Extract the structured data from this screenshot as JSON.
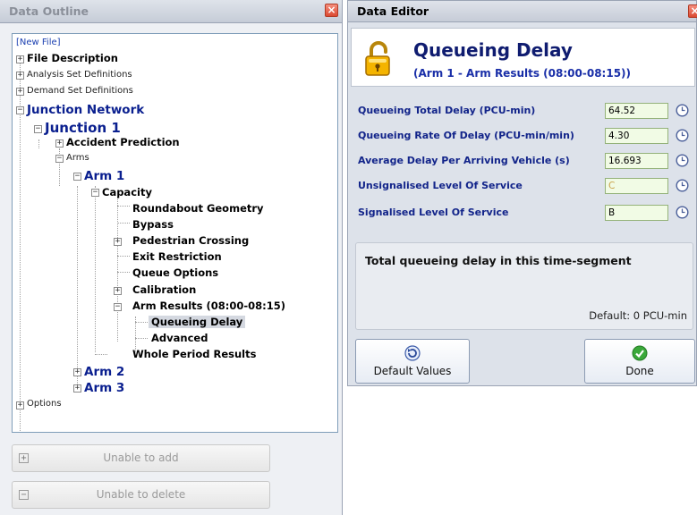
{
  "outline": {
    "title": "Data Outline",
    "tree": {
      "new_file": "[New File]",
      "file_description": "File Description",
      "analysis_sets": "Analysis Set Definitions",
      "demand_sets": "Demand Set Definitions",
      "junction_network": "Junction Network",
      "junction_1": "Junction 1",
      "accident_prediction": "Accident Prediction",
      "arms": "Arms",
      "arm_1": "Arm 1",
      "capacity": "Capacity",
      "roundabout_geometry": "Roundabout Geometry",
      "bypass": "Bypass",
      "pedestrian_crossing": "Pedestrian Crossing",
      "exit_restriction": "Exit Restriction",
      "queue_options": "Queue Options",
      "calibration": "Calibration",
      "arm_results": "Arm Results (08:00-08:15)",
      "queueing_delay": "Queueing Delay",
      "advanced": "Advanced",
      "whole_period_results": "Whole Period Results",
      "arm_2": "Arm 2",
      "arm_3": "Arm 3",
      "options": "Options"
    },
    "buttons": {
      "add": "Unable to add",
      "delete": "Unable to delete"
    }
  },
  "editor": {
    "title": "Data Editor",
    "heading": "Queueing Delay",
    "subheading": "(Arm 1 - Arm Results (08:00-08:15))",
    "fields": [
      {
        "label": "Queueing Total Delay (PCU-min)",
        "value": "64.52"
      },
      {
        "label": "Queueing Rate Of Delay (PCU-min/min)",
        "value": "4.30"
      },
      {
        "label": "Average Delay Per Arriving Vehicle (s)",
        "value": "16.693"
      },
      {
        "label": "Unsignalised Level Of Service",
        "value": "C"
      },
      {
        "label": "Signalised Level Of Service",
        "value": "B"
      }
    ],
    "description": "Total queueing delay in this time-segment",
    "default_text": "Default: 0 PCU-min",
    "buttons": {
      "default_values": "Default Values",
      "done": "Done"
    }
  },
  "colors": {
    "accent_blue": "#0a1f8f",
    "field_bg": "#f1fbe5",
    "close_red": "#db4a31"
  }
}
